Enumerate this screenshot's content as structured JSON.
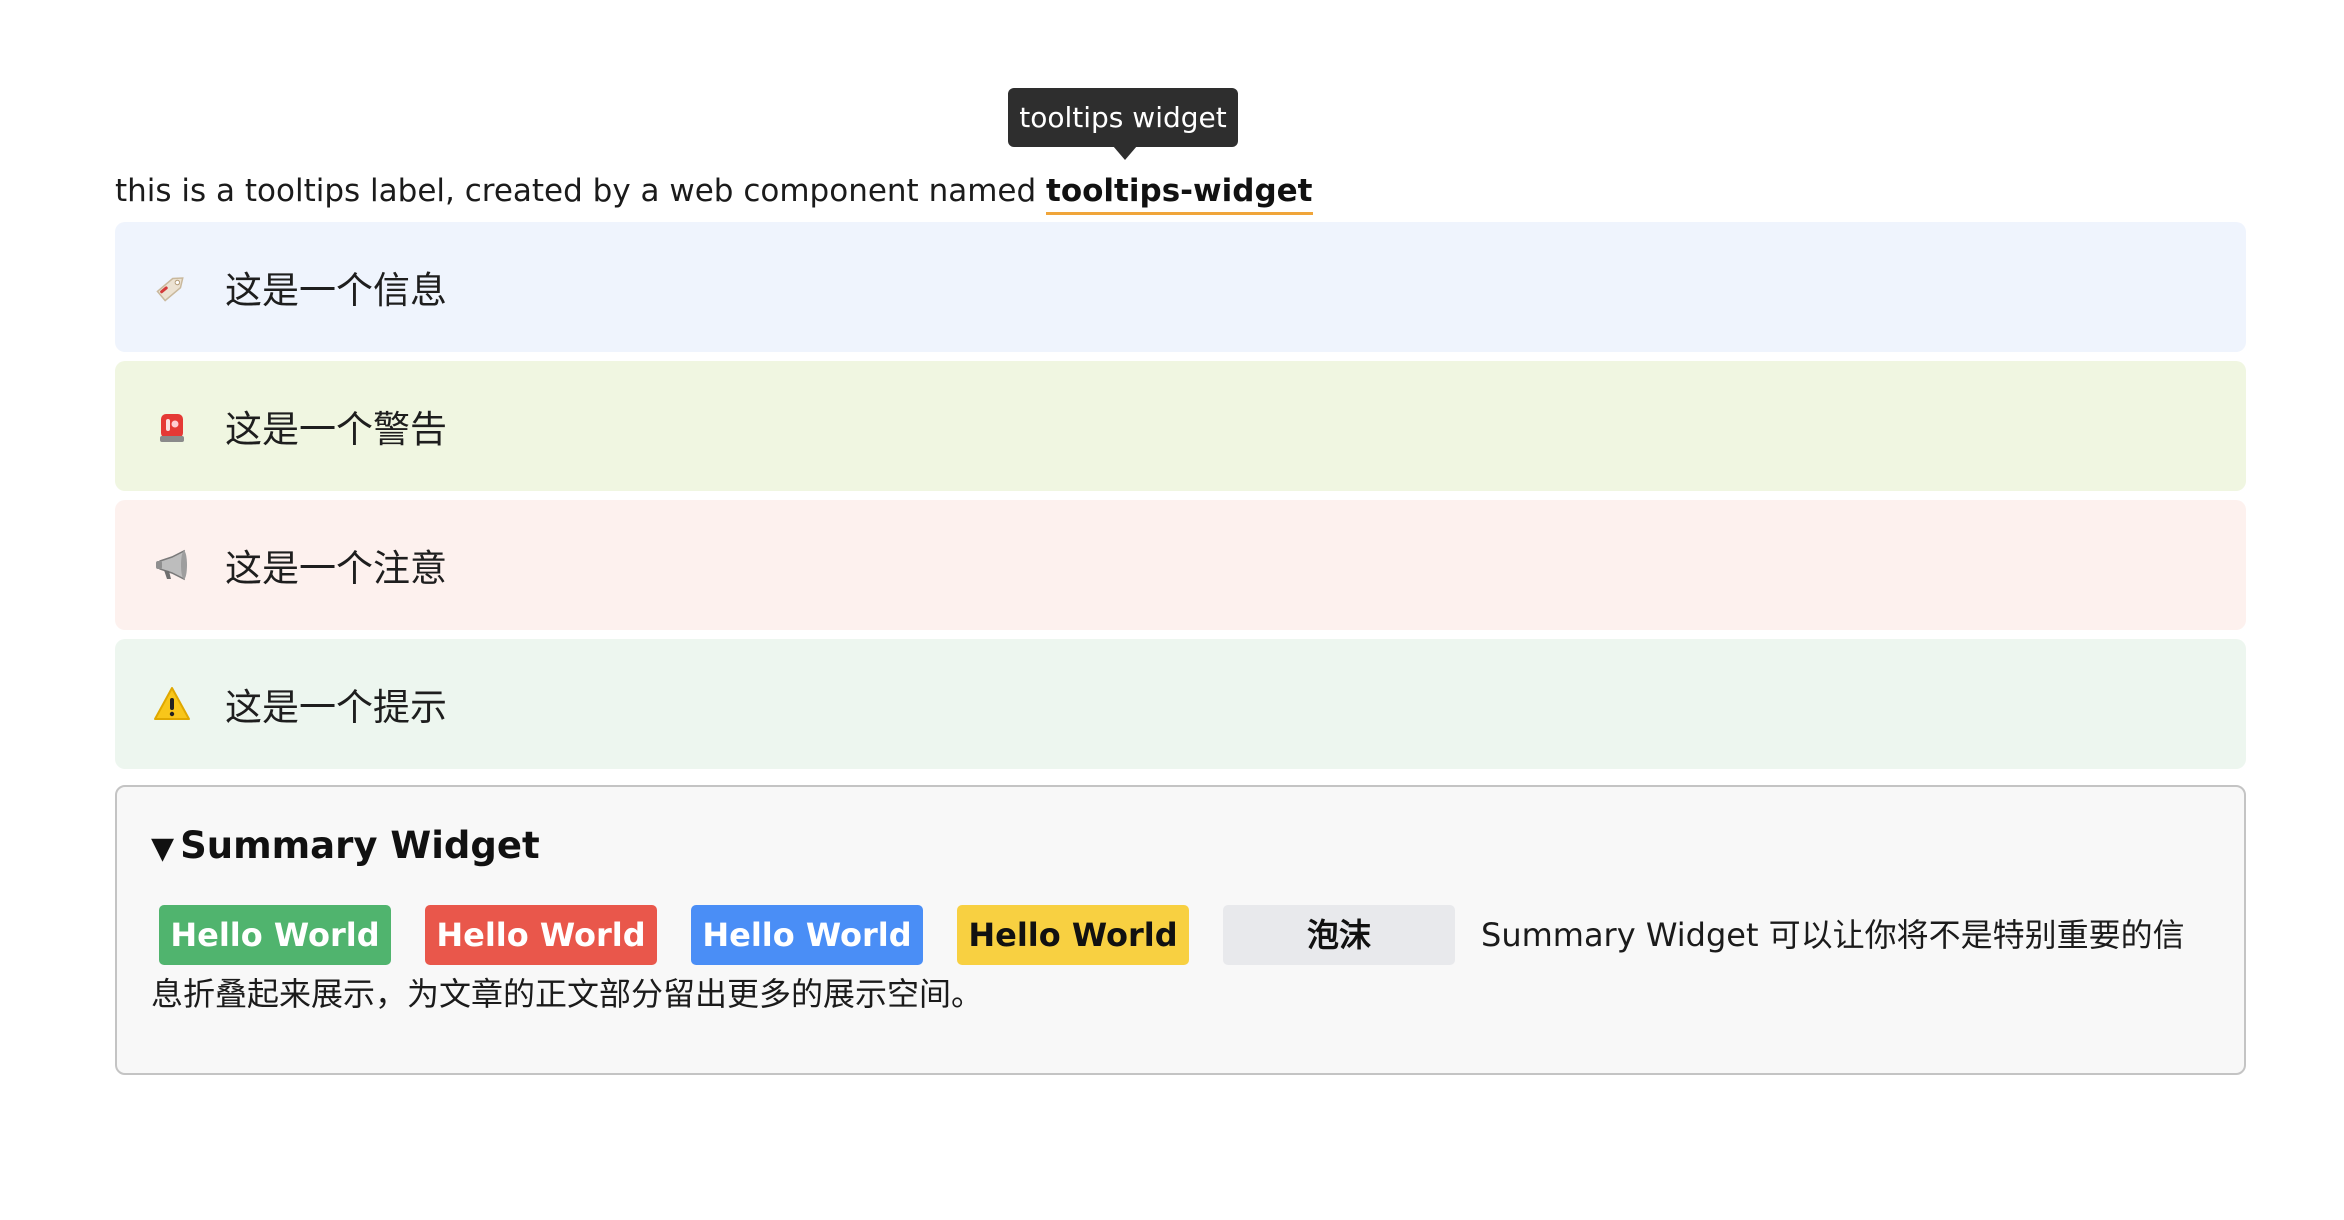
{
  "tooltip": {
    "bubble_text": "tooltips widget",
    "line_prefix": "this is a tooltips label, created by a web component named ",
    "target_text": "tooltips-widget",
    "underline_color": "#f0a53a"
  },
  "callouts": [
    {
      "icon": "tag-icon",
      "text": "这是一个信息",
      "bg": "#eff4fd"
    },
    {
      "icon": "siren-icon",
      "text": "这是一个警告",
      "bg": "#f0f6e1"
    },
    {
      "icon": "megaphone-icon",
      "text": "这是一个注意",
      "bg": "#fdf1ee"
    },
    {
      "icon": "warning-icon",
      "text": "这是一个提示",
      "bg": "#edf6ef"
    }
  ],
  "summary": {
    "marker": "▼",
    "title": "Summary Widget",
    "pills": [
      {
        "label": "Hello World",
        "color": "#50b46e"
      },
      {
        "label": "Hello World",
        "color": "#e9574b"
      },
      {
        "label": "Hello World",
        "color": "#4a8ef6"
      },
      {
        "label": "Hello World",
        "color": "#f8d041"
      },
      {
        "label": "泡沫",
        "color": "#e8e9ec"
      }
    ],
    "body_text": "Summary Widget 可以让你将不是特别重要的信息折叠起来展示，为文章的正文部分留出更多的展示空间。"
  }
}
